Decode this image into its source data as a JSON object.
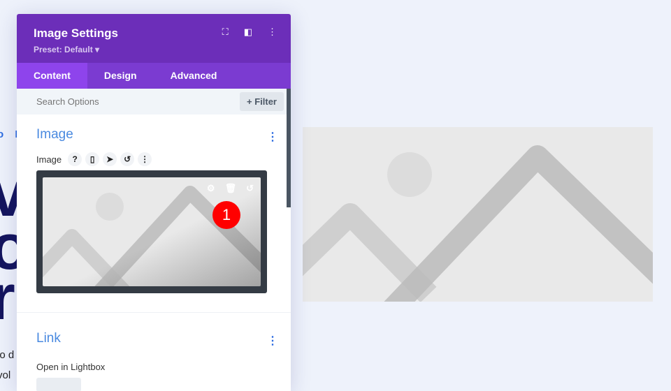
{
  "background": {
    "crumb": "o D",
    "big_lines": [
      "v",
      "o",
      "r"
    ],
    "small_lines": [
      "io d",
      "vol"
    ]
  },
  "panel": {
    "title": "Image Settings",
    "preset": "Preset: Default ▾",
    "header_icons": [
      "focus-icon",
      "split-view-icon",
      "more-icon"
    ],
    "tabs": [
      {
        "label": "Content",
        "active": true
      },
      {
        "label": "Design"
      },
      {
        "label": "Advanced"
      }
    ],
    "search": {
      "placeholder": "Search Options",
      "filter_label": "+ Filter"
    },
    "image_section": {
      "title": "Image",
      "field_label": "Image",
      "field_icons": [
        "help-icon",
        "mobile-icon",
        "pointer-icon",
        "reset-icon",
        "more-icon"
      ],
      "overlay_icons": [
        "gear-icon",
        "trash-icon",
        "undo-icon"
      ],
      "badge": "1"
    },
    "link_section": {
      "title": "Link",
      "field_label": "Open in Lightbox"
    }
  },
  "colors": {
    "header": "#6c2eb9",
    "tabs": "#7b3bd1",
    "active_tab": "#8e44ec",
    "section_title": "#4a8ae0",
    "badge": "#ff0000"
  }
}
